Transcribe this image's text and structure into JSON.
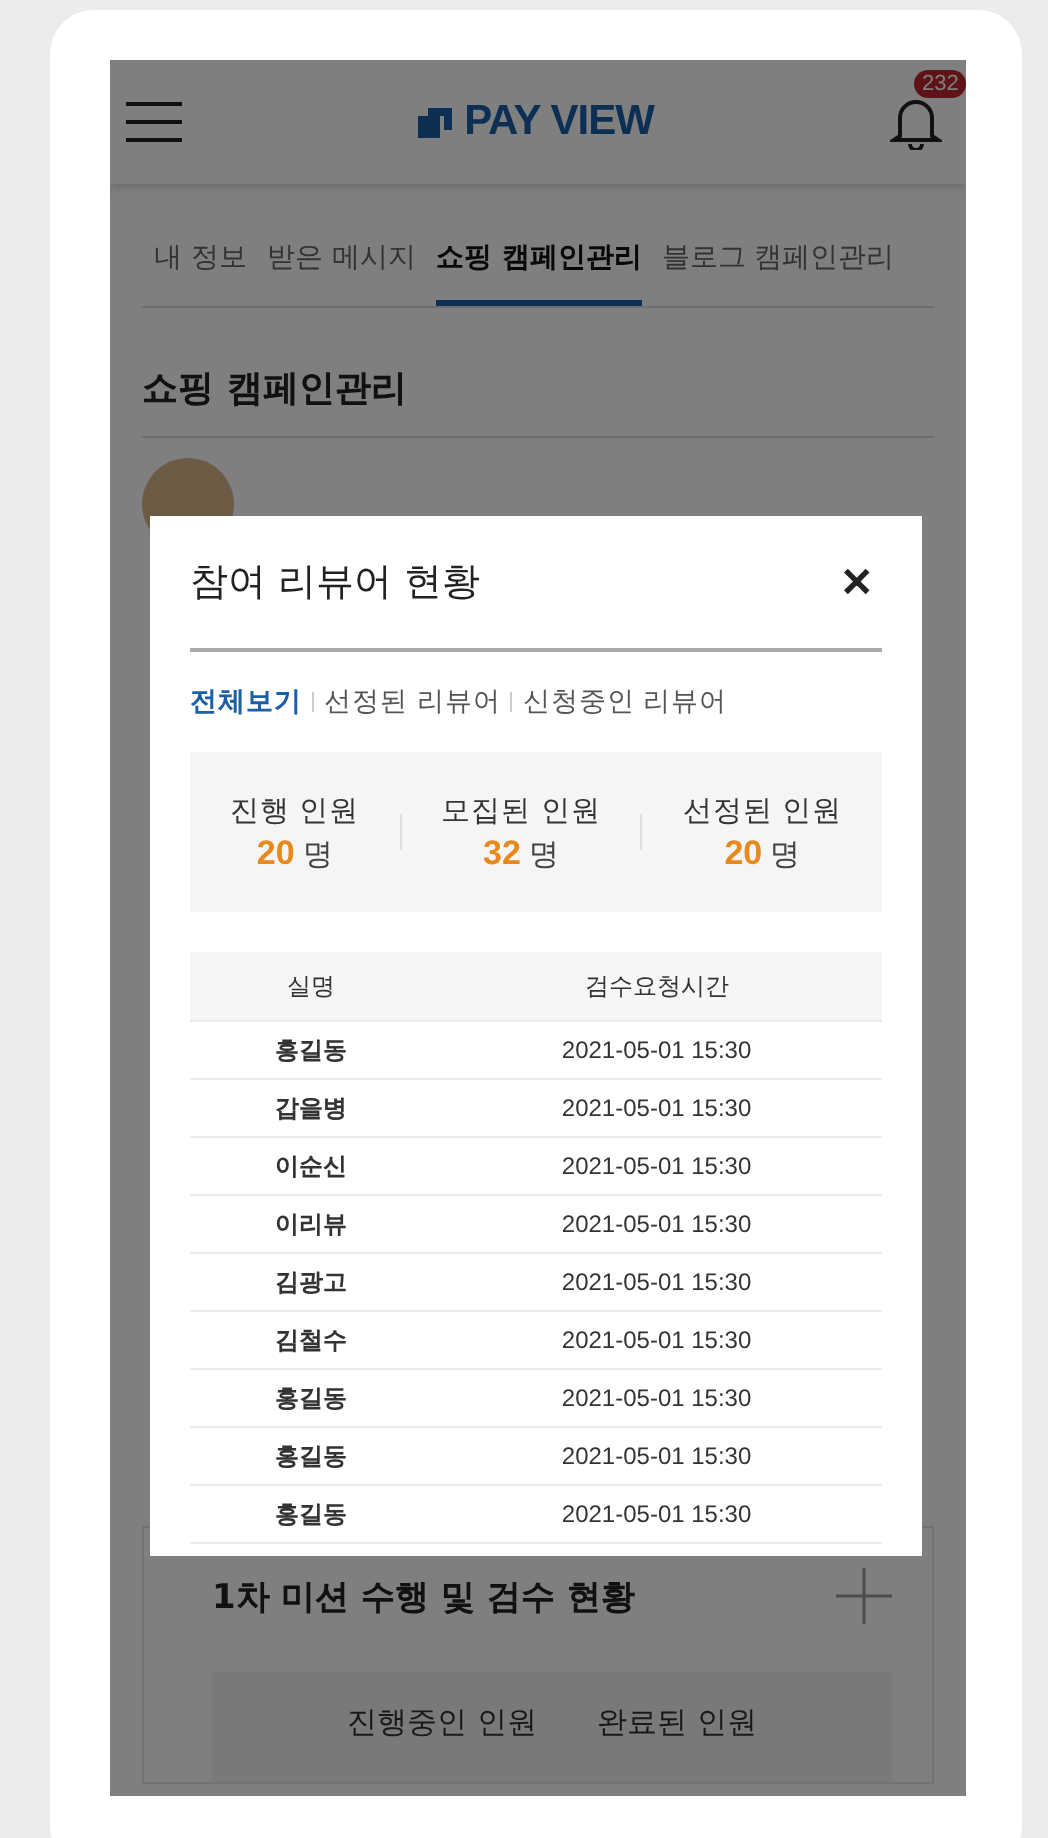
{
  "header": {
    "logo": "PAY VIEW",
    "notification_count": "232"
  },
  "tabs": [
    {
      "label": "내 정보",
      "selected": false
    },
    {
      "label": "받은 메시지",
      "selected": false
    },
    {
      "label": "쇼핑 캠페인관리",
      "selected": true
    },
    {
      "label": "블로그 캠페인관리",
      "selected": false
    }
  ],
  "section_title": "쇼핑 캠페인관리",
  "modal": {
    "title": "참여 리뷰어 현황",
    "close": "✕",
    "filters": [
      {
        "label": "전체보기",
        "selected": true
      },
      {
        "label": "선정된 리뷰어",
        "selected": false
      },
      {
        "label": "신청중인 리뷰어",
        "selected": false
      }
    ],
    "stats": [
      {
        "label": "진행 인원",
        "value": "20",
        "unit": "명"
      },
      {
        "label": "모집된 인원",
        "value": "32",
        "unit": "명"
      },
      {
        "label": "선정된 인원",
        "value": "20",
        "unit": "명"
      }
    ],
    "table": {
      "columns": [
        "실명",
        "검수요청시간"
      ],
      "rows": [
        [
          "홍길동",
          "2021-05-01 15:30"
        ],
        [
          "갑을병",
          "2021-05-01 15:30"
        ],
        [
          "이순신",
          "2021-05-01 15:30"
        ],
        [
          "이리뷰",
          "2021-05-01 15:30"
        ],
        [
          "김광고",
          "2021-05-01 15:30"
        ],
        [
          "김철수",
          "2021-05-01 15:30"
        ],
        [
          "홍길동",
          "2021-05-01 15:30"
        ],
        [
          "홍길동",
          "2021-05-01 15:30"
        ],
        [
          "홍길동",
          "2021-05-01 15:30"
        ]
      ]
    }
  },
  "mission": {
    "title": "1차 미션 수행 및 검수 현황",
    "columns": [
      "진행중인 인원",
      "완료된 인원"
    ]
  }
}
